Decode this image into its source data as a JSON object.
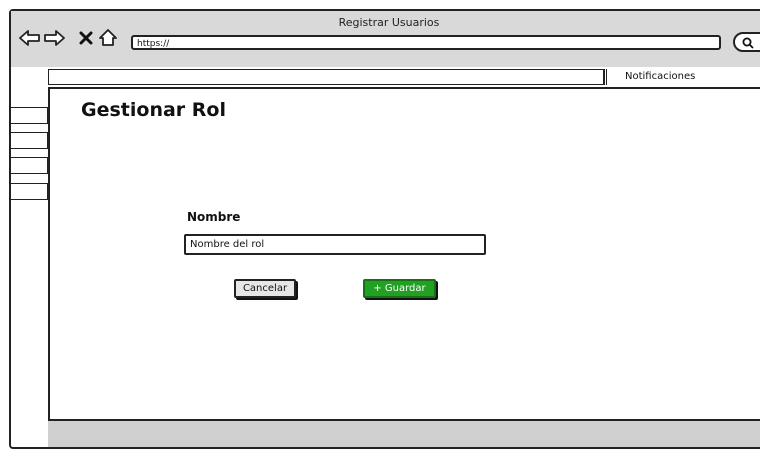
{
  "window": {
    "title": "Registrar Usuarios"
  },
  "browser": {
    "url": "https://",
    "icons": [
      "back-arrow-icon",
      "forward-arrow-icon",
      "close-icon",
      "home-icon",
      "search-icon"
    ]
  },
  "topbar": {
    "notifications_label": "Notificaciones"
  },
  "sidebar": {
    "items": [
      "",
      "",
      "",
      ""
    ]
  },
  "page": {
    "title": "Gestionar Rol"
  },
  "form": {
    "name_label": "Nombre",
    "name_value": "Nombre del rol"
  },
  "actions": {
    "cancel_label": "Cancelar",
    "save_label": "+ Guardar",
    "save_color": "#21a121"
  }
}
